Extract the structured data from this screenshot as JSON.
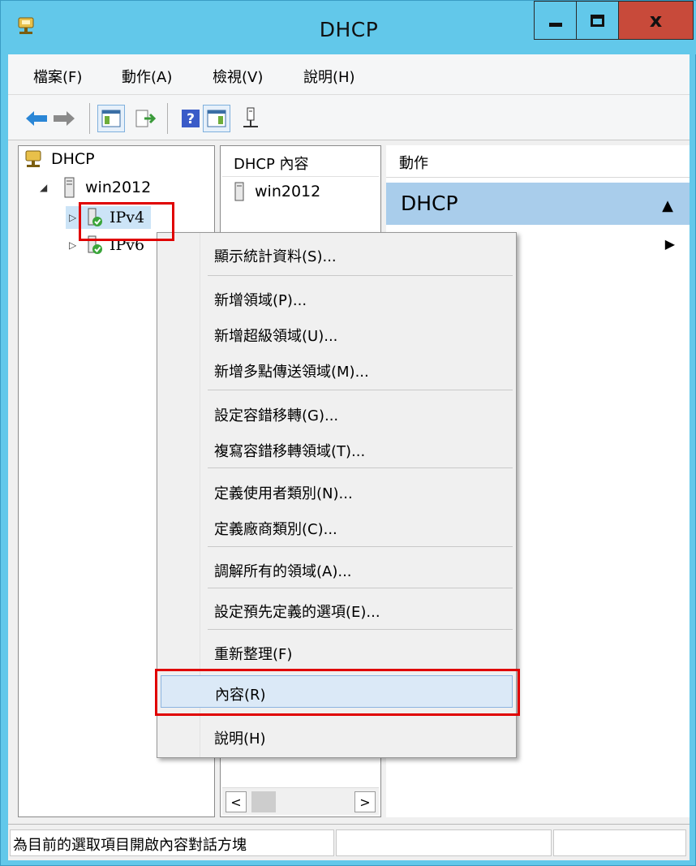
{
  "window": {
    "title": "DHCP",
    "close_label": "x",
    "colors": {
      "titlebar": "#62c8ea",
      "close": "#c84a3a",
      "highlight": "#e00000"
    }
  },
  "menubar": {
    "items": [
      "檔案(F)",
      "動作(A)",
      "檢視(V)",
      "說明(H)"
    ]
  },
  "toolbar": {
    "buttons": [
      "back-icon",
      "forward-icon",
      "show-hide-console-tree-icon",
      "export-list-icon",
      "help-icon",
      "show-hide-action-pane-icon",
      "server-icon"
    ]
  },
  "tree": {
    "root": "DHCP",
    "server": "win2012",
    "ipv4": "IPv4",
    "ipv6": "IPv6"
  },
  "middle": {
    "header": "DHCP 內容",
    "item": "win2012"
  },
  "actions": {
    "header": "動作",
    "group": "DHCP"
  },
  "context_menu": {
    "items": [
      "顯示統計資料(S)...",
      "新增領域(P)...",
      "新增超級領域(U)...",
      "新增多點傳送領域(M)...",
      "設定容錯移轉(G)...",
      "複寫容錯移轉領域(T)...",
      "定義使用者類別(N)...",
      "定義廠商類別(C)...",
      "調解所有的領域(A)...",
      "設定預先定義的選項(E)...",
      "重新整理(F)",
      "內容(R)",
      "說明(H)"
    ],
    "highlighted": "內容(R)"
  },
  "statusbar": {
    "text": "為目前的選取項目開啟內容對話方塊"
  }
}
